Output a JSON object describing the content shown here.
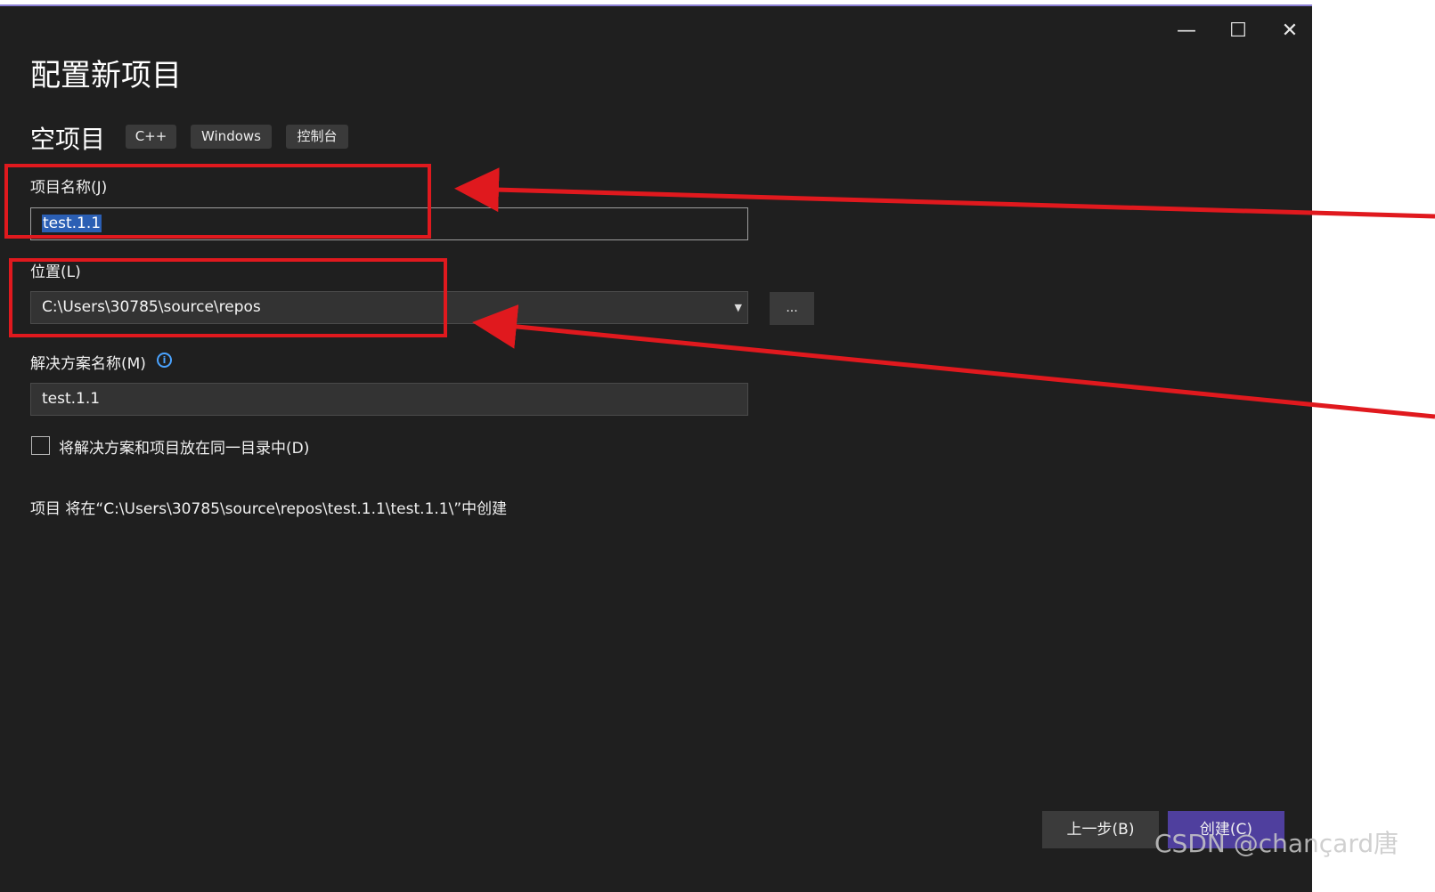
{
  "window": {
    "title": "配置新项目",
    "controls": {
      "minimize": "—",
      "maximize": "☐",
      "close": "✕"
    }
  },
  "template": {
    "name": "空项目",
    "tags": [
      "C++",
      "Windows",
      "控制台"
    ]
  },
  "form": {
    "project_name_label": "项目名称(J)",
    "project_name_value": "test.1.1",
    "location_label": "位置(L)",
    "location_value": "C:\\Users\\30785\\source\\repos",
    "browse_label": "...",
    "solution_name_label": "解决方案名称(M)",
    "solution_name_value": "test.1.1",
    "same_dir_checkbox_label": "将解决方案和项目放在同一目录中(D)",
    "same_dir_checked": false,
    "info_text": "项目 将在“C:\\Users\\30785\\source\\repos\\test.1.1\\test.1.1\\”中创建"
  },
  "footer": {
    "back_label": "上一步(B)",
    "create_label": "创建(C)"
  },
  "watermark": "CSDN @chançard唐",
  "colors": {
    "window_bg": "#1f1f1f",
    "accent": "#4f3f9e",
    "annotation_red": "#e0191e",
    "selection": "#2b5fb4"
  }
}
